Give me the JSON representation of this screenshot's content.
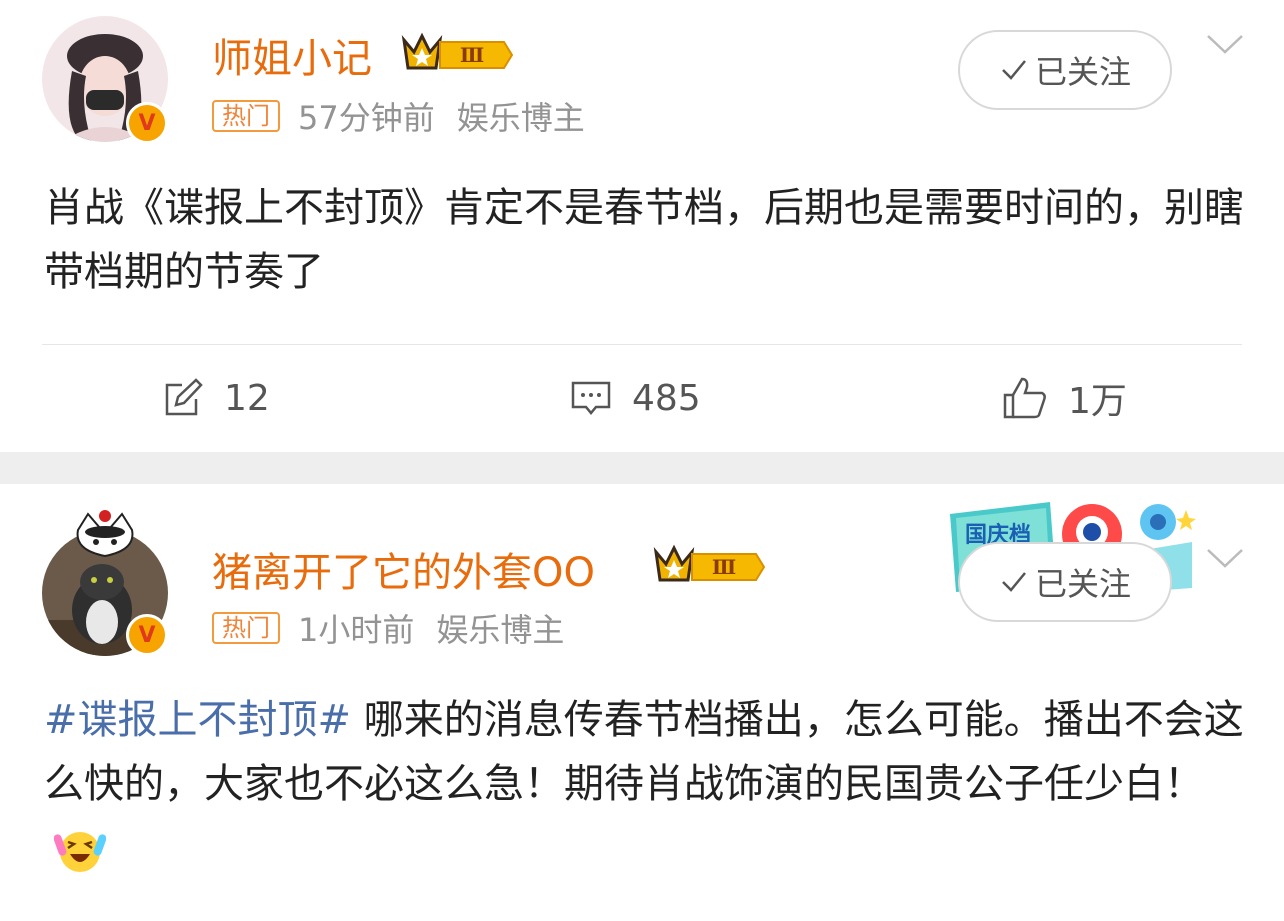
{
  "post1": {
    "username": "师姐小记",
    "level_badge": "Ⅲ",
    "hot_tag": "热门",
    "time": "57分钟前",
    "category": "娱乐博主",
    "follow_label": "已关注",
    "content": "肖战《谍报上不封顶》肯定不是春节档，后期也是需要时间的，别瞎带档期的节奏了",
    "repost_count": "12",
    "comment_count": "485",
    "like_count": "1万"
  },
  "post2": {
    "username": "猪离开了它的外套OO",
    "level_badge": "Ⅲ",
    "hot_tag": "热门",
    "time": "1小时前",
    "category": "娱乐博主",
    "follow_label": "已关注",
    "hashtag": "#谍报上不封顶#",
    "content": " 哪来的消息传春节档播出，怎么可能。播出不会这么快的，大家也不必这么急！期待肖战饰演的民国贵公子任少白！",
    "banner_text": "国庆档"
  },
  "icons": [
    "v-badge-icon",
    "crown-icon",
    "checkmark-icon",
    "chevron-down-icon",
    "repost-icon",
    "comment-icon",
    "like-icon",
    "emoji-laugh-icon"
  ],
  "colors": {
    "username": "#e86b0c",
    "hot_tag": "#f0843a",
    "hashtag": "#4a6ea9",
    "separator": "#eeeeee"
  }
}
